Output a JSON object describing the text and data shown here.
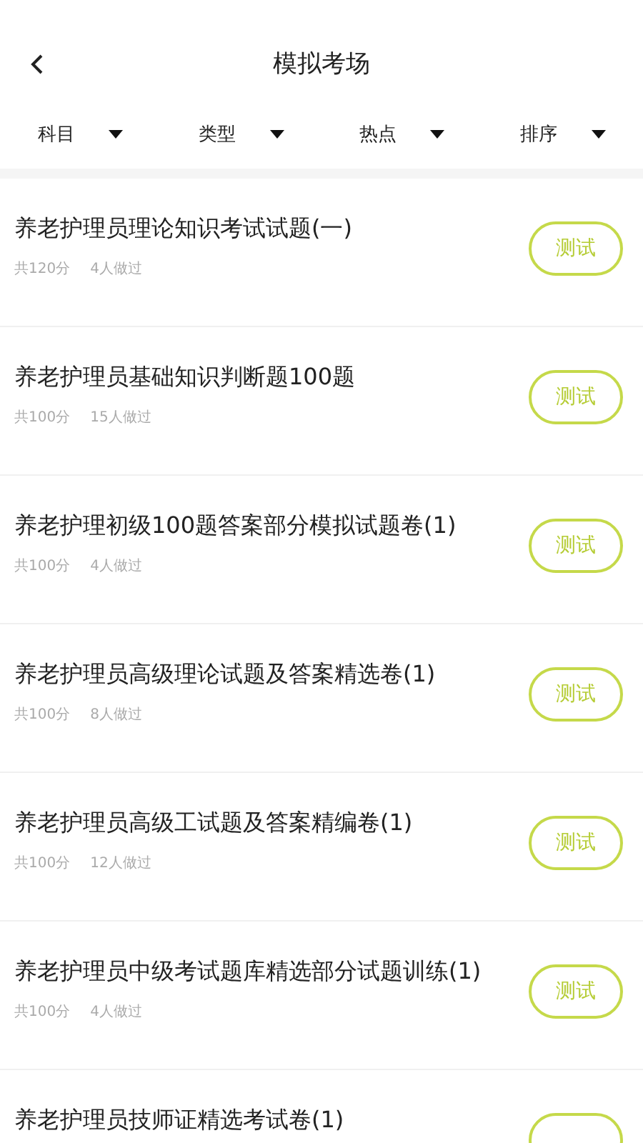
{
  "header": {
    "title": "模拟考场"
  },
  "filters": [
    {
      "label": "科目"
    },
    {
      "label": "类型"
    },
    {
      "label": "热点"
    },
    {
      "label": "排序"
    }
  ],
  "exams": [
    {
      "title": "养老护理员理论知识考试试题(一)",
      "score": "共120分",
      "taken": "4人做过",
      "action": "测试"
    },
    {
      "title": "养老护理员基础知识判断题100题",
      "score": "共100分",
      "taken": "15人做过",
      "action": "测试"
    },
    {
      "title": "养老护理初级100题答案部分模拟试题卷(1)",
      "score": "共100分",
      "taken": "4人做过",
      "action": "测试"
    },
    {
      "title": "养老护理员高级理论试题及答案精选卷(1)",
      "score": "共100分",
      "taken": "8人做过",
      "action": "测试"
    },
    {
      "title": "养老护理员高级工试题及答案精编卷(1)",
      "score": "共100分",
      "taken": "12人做过",
      "action": "测试"
    },
    {
      "title": "养老护理员中级考试题库精选部分试题训练(1)",
      "score": "共100分",
      "taken": "4人做过",
      "action": "测试"
    },
    {
      "title": "养老护理员技师证精选考试卷(1)"
    }
  ]
}
